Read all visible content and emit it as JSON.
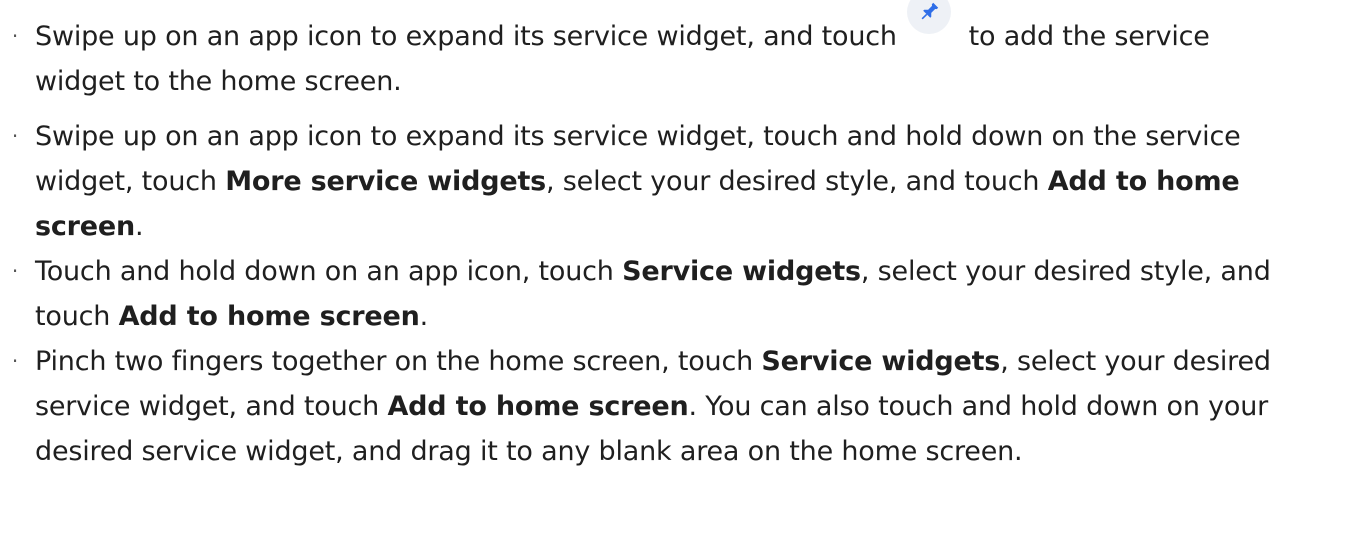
{
  "bullet_symbol": "·",
  "icons": {
    "pin": "pin-icon"
  },
  "colors": {
    "text": "#1f1f1f",
    "pin_icon": "#2f6ee8",
    "pin_bg": "#eef1f6"
  },
  "items": [
    {
      "line1_part1": "Swipe up on an app icon to expand its service widget, and touch",
      "line1_part2": "to add the service",
      "line2": "widget to the home screen."
    },
    {
      "line1": "Swipe up on an app icon to expand its service widget, touch and hold down on the service",
      "line2_a": "widget, touch ",
      "line2_b": "More service widgets",
      "line2_c": ", select your desired style, and touch ",
      "line2_d": "Add to home",
      "line3_a": "screen",
      "line3_b": "."
    },
    {
      "line1_a": "Touch and hold down on an app icon, touch ",
      "line1_b": "Service widgets",
      "line1_c": ", select your desired style, and",
      "line2_a": "touch ",
      "line2_b": "Add to home screen",
      "line2_c": "."
    },
    {
      "line1_a": "Pinch two fingers together on the home screen, touch ",
      "line1_b": "Service widgets",
      "line1_c": ", select your desired",
      "line2_a": "service widget, and touch ",
      "line2_b": "Add to home screen",
      "line2_c": ". You can also touch and hold down on your",
      "line3": "desired service widget, and drag it to any blank area on the home screen."
    }
  ]
}
